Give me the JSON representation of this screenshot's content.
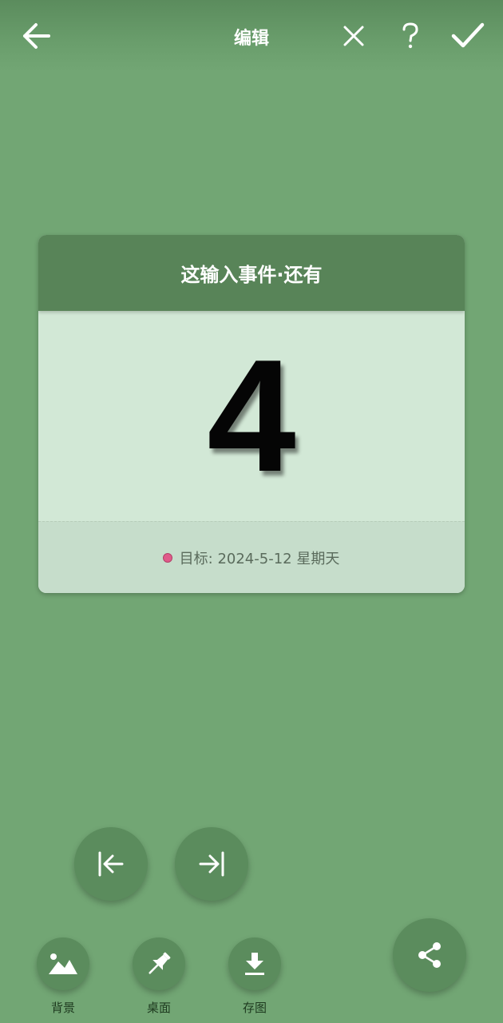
{
  "header": {
    "title": "编辑",
    "icons": [
      "back-arrow-icon",
      "close-icon",
      "help-icon",
      "check-icon"
    ]
  },
  "card": {
    "title": "这输入事件·还有",
    "count": "4",
    "target_label": "目标: 2024-5-12 星期天"
  },
  "nav": {
    "icons": [
      "skip-to-start-icon",
      "skip-to-end-icon"
    ]
  },
  "tools": [
    {
      "label": "背景",
      "icon": "image-icon"
    },
    {
      "label": "桌面",
      "icon": "pin-icon"
    },
    {
      "label": "存图",
      "icon": "download-icon"
    }
  ],
  "share": {
    "icon": "share-icon"
  },
  "colors": {
    "background": "#72a674",
    "accent": "#588458",
    "card_body": "#d2e8d6",
    "card_footer": "#c6ddcb",
    "dot": "#e05a8a"
  }
}
